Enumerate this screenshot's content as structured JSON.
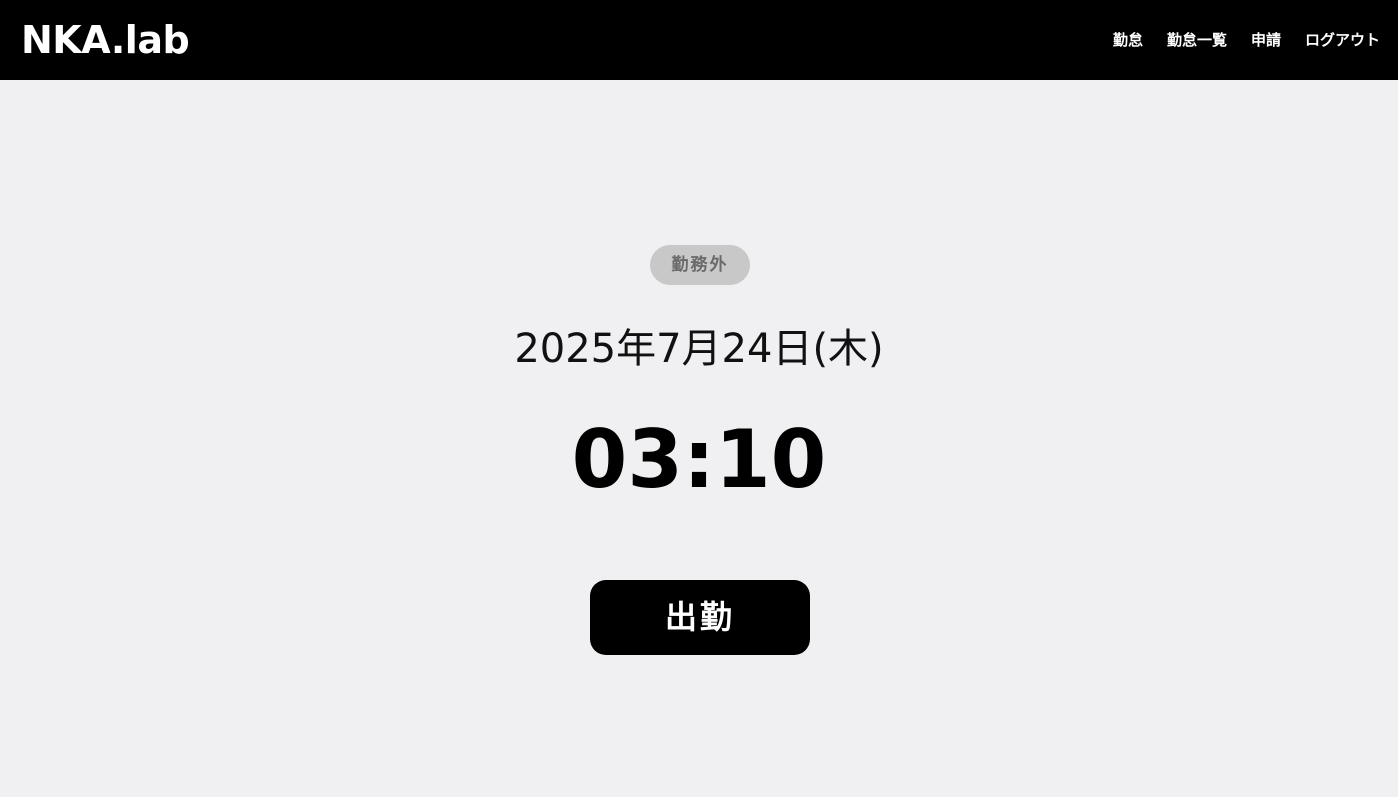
{
  "header": {
    "logo": "NKA.lab",
    "nav": [
      "勤怠",
      "勤怠一覧",
      "申請",
      "ログアウト"
    ]
  },
  "main": {
    "status_badge": "勤務外",
    "date": "2025年7月24日(木)",
    "time": "03:10",
    "clock_in_label": "出勤"
  },
  "colors": {
    "header_bg": "#000000",
    "page_bg": "#f0f0f2",
    "badge_bg": "#c8c8c8",
    "badge_text": "#6a6a6a",
    "button_bg": "#000000",
    "button_text": "#ffffff"
  }
}
